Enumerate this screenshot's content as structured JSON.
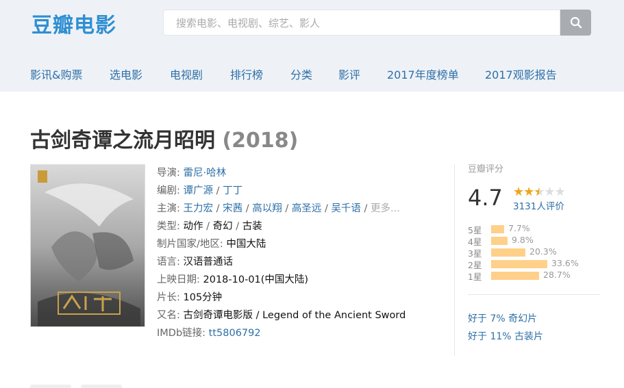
{
  "header": {
    "logo_text": "豆瓣电影",
    "search_placeholder": "搜索电影、电视剧、综艺、影人"
  },
  "nav": [
    "影讯&购票",
    "选电影",
    "电视剧",
    "排行榜",
    "分类",
    "影评",
    "2017年度榜单",
    "2017观影报告"
  ],
  "movie": {
    "title": "古剑奇谭之流月昭明",
    "year": "(2018)",
    "director_label": "导演",
    "director": "雷尼·哈林",
    "writer_label": "编剧",
    "writers": [
      "谭广源",
      "丁丁"
    ],
    "cast_label": "主演",
    "cast": [
      "王力宏",
      "宋茜",
      "高以翔",
      "高圣远",
      "吴千语"
    ],
    "cast_more": "更多...",
    "genre_label": "类型",
    "genres": [
      "动作",
      "奇幻",
      "古装"
    ],
    "country_label": "制片国家/地区",
    "country": "中国大陆",
    "language_label": "语言",
    "language": "汉语普通话",
    "release_label": "上映日期",
    "release": "2018-10-01(中国大陆)",
    "runtime_label": "片长",
    "runtime": "105分钟",
    "aka_label": "又名",
    "aka": "古剑奇谭电影版 / Legend of the Ancient Sword",
    "imdb_label": "IMDb链接",
    "imdb": "tt5806792"
  },
  "rating": {
    "label": "豆瓣评分",
    "score": "4.7",
    "stars_value": 2.5,
    "votes": "3131人评价",
    "breakdown": [
      {
        "label": "5星",
        "percent": 7.7,
        "text": "7.7%"
      },
      {
        "label": "4星",
        "percent": 9.8,
        "text": "9.8%"
      },
      {
        "label": "3星",
        "percent": 20.3,
        "text": "20.3%"
      },
      {
        "label": "2星",
        "percent": 33.6,
        "text": "33.6%"
      },
      {
        "label": "1星",
        "percent": 28.7,
        "text": "28.7%"
      }
    ],
    "better_than": [
      "好于 7% 奇幻片",
      "好于 11% 古装片"
    ]
  }
}
